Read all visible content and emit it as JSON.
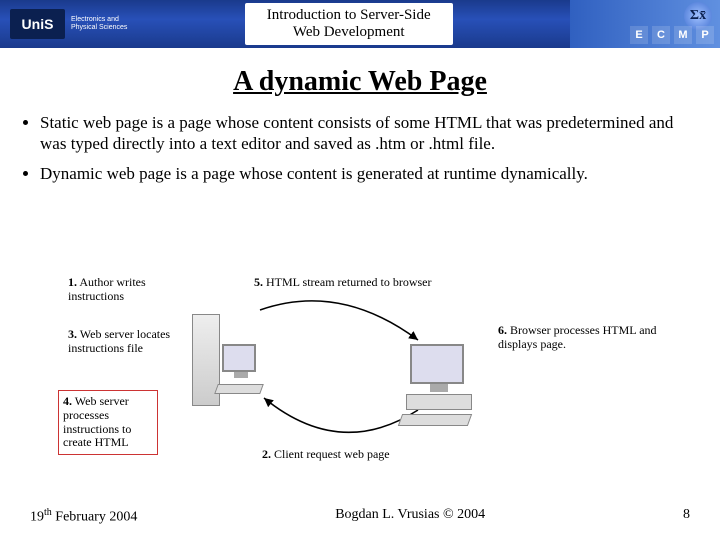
{
  "header": {
    "logo_text": "UniS",
    "logo_sub1": "Electronics and",
    "logo_sub2": "Physical Sciences",
    "title_line1": "Introduction to Server-Side",
    "title_line2": "Web Development",
    "sigma": "Σx̄",
    "letters": [
      "E",
      "C",
      "M",
      "P"
    ]
  },
  "slide_title": "A dynamic Web Page",
  "bullets": [
    "Static web page is a page whose content consists of some HTML that was predetermined and was typed directly into a text editor and saved as .htm or .html file.",
    "Dynamic web page is a page whose content is generated at runtime dynamically."
  ],
  "captions": {
    "c1": {
      "bold": "1.",
      "text": " Author writes instructions"
    },
    "c2": {
      "bold": "2.",
      "text": " Client request web page"
    },
    "c3": {
      "bold": "3.",
      "text": " Web server locates instructions file"
    },
    "c4": {
      "bold": "4.",
      "text": " Web server processes instructions to create HTML"
    },
    "c5": {
      "bold": "5.",
      "text": " HTML stream returned to browser"
    },
    "c6": {
      "bold": "6.",
      "text": " Browser processes HTML and displays page."
    }
  },
  "footer": {
    "date_day": "19",
    "date_suffix": "th",
    "date_rest": " February 2004",
    "center": "Bogdan L. Vrusias © 2004",
    "page": "8"
  }
}
